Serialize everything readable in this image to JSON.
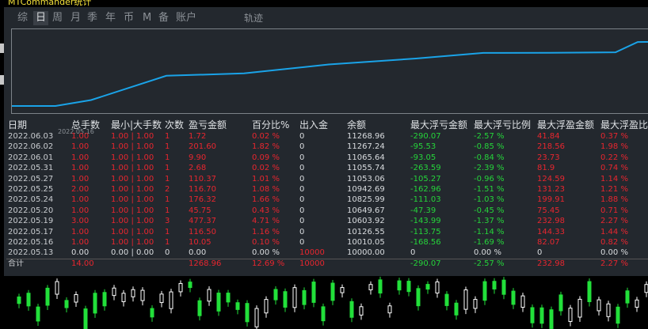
{
  "window": {
    "title": "MTCommander统计"
  },
  "tabs": [
    {
      "label": "综",
      "active": false
    },
    {
      "label": "日",
      "active": true
    },
    {
      "label": "周",
      "active": false
    },
    {
      "label": "月",
      "active": false
    },
    {
      "label": "季",
      "active": false
    },
    {
      "label": "年",
      "active": false
    },
    {
      "label": "币",
      "active": false
    },
    {
      "label": "M",
      "active": false
    },
    {
      "label": "备",
      "active": false
    },
    {
      "label": "账户",
      "active": false
    }
  ],
  "track_label": "轨迹",
  "chart_data": {
    "type": "line",
    "x_first_label": "2022.05.16",
    "series": [
      {
        "values": [
          10010.05,
          10010.05,
          10126.55,
          10603.92,
          10649.67,
          10825.99,
          10942.69,
          11053.06,
          11055.74,
          11065.64,
          11267.24,
          11268.96,
          11268.96
        ]
      }
    ],
    "color": "#1aa3e8"
  },
  "table": {
    "columns": [
      "日期",
      "总手数",
      "最小|大手数",
      "次数",
      "盈亏金额",
      "百分比%",
      "出入金",
      "余额",
      "最大浮亏金额",
      "最大浮亏比例",
      "最大浮盈金额",
      "最大浮盈比"
    ],
    "rows": [
      [
        "2022.06.03",
        "1.00",
        "1.00 | 1.00",
        "1",
        "1.72",
        "0.02 %",
        "0",
        "11268.96",
        "-290.07",
        "-2.57 %",
        "41.84",
        "0.37 %"
      ],
      [
        "2022.06.02",
        "1.00",
        "1.00 | 1.00",
        "1",
        "201.60",
        "1.82 %",
        "0",
        "11267.24",
        "-95.53",
        "-0.85 %",
        "218.56",
        "1.98 %"
      ],
      [
        "2022.06.01",
        "1.00",
        "1.00 | 1.00",
        "1",
        "9.90",
        "0.09 %",
        "0",
        "11065.64",
        "-93.05",
        "-0.84 %",
        "23.73",
        "0.22 %"
      ],
      [
        "2022.05.31",
        "1.00",
        "1.00 | 1.00",
        "1",
        "2.68",
        "0.02 %",
        "0",
        "11055.74",
        "-263.59",
        "-2.39 %",
        "81.9",
        "0.74 %"
      ],
      [
        "2022.05.27",
        "1.00",
        "1.00 | 1.00",
        "1",
        "110.37",
        "1.01 %",
        "0",
        "11053.06",
        "-105.27",
        "-0.96 %",
        "124.59",
        "1.14 %"
      ],
      [
        "2022.05.25",
        "2.00",
        "1.00 | 1.00",
        "2",
        "116.70",
        "1.08 %",
        "0",
        "10942.69",
        "-162.96",
        "-1.51 %",
        "131.23",
        "1.21 %"
      ],
      [
        "2022.05.24",
        "1.00",
        "1.00 | 1.00",
        "1",
        "176.32",
        "1.66 %",
        "0",
        "10825.99",
        "-111.03",
        "-1.03 %",
        "199.91",
        "1.88 %"
      ],
      [
        "2022.05.20",
        "1.00",
        "1.00 | 1.00",
        "1",
        "45.75",
        "0.43 %",
        "0",
        "10649.67",
        "-47.39",
        "-0.45 %",
        "75.45",
        "0.71 %"
      ],
      [
        "2022.05.19",
        "3.00",
        "1.00 | 1.00",
        "3",
        "477.37",
        "4.71 %",
        "0",
        "10603.92",
        "-143.99",
        "-1.37 %",
        "232.98",
        "2.27 %"
      ],
      [
        "2022.05.17",
        "1.00",
        "1.00 | 1.00",
        "1",
        "116.50",
        "1.16 %",
        "0",
        "10126.55",
        "-113.75",
        "-1.14 %",
        "144.33",
        "1.44 %"
      ],
      [
        "2022.05.16",
        "1.00",
        "1.00 | 1.00",
        "1",
        "10.05",
        "0.10 %",
        "0",
        "10010.05",
        "-168.56",
        "-1.69 %",
        "82.07",
        "0.82 %"
      ],
      [
        "2022.05.13",
        "0.00",
        "0.00 | 0.00",
        "0",
        "0.00",
        "0.00 %",
        "10000",
        "10000.00",
        "0",
        "0.00 %",
        "0",
        "0.00 %"
      ]
    ],
    "total": [
      "合计",
      "14.00",
      "",
      "",
      "1268.96",
      "12.69 %",
      "10000",
      "",
      "-290.07",
      "-2.57 %",
      "232.98",
      "2.27 %"
    ]
  },
  "colors": {
    "positive": "#e8262f",
    "negative": "#25d43a",
    "neutral": "#d9dcdf",
    "title": "#f5e23a"
  }
}
